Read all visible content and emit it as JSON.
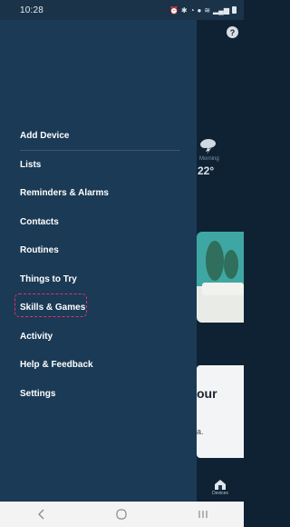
{
  "status_bar": {
    "time": "10:28"
  },
  "drawer": {
    "menu_items": [
      {
        "label": "Add Device",
        "divider": true
      },
      {
        "label": "Lists",
        "divider": false
      },
      {
        "label": "Reminders & Alarms",
        "divider": false
      },
      {
        "label": "Contacts",
        "divider": false
      },
      {
        "label": "Routines",
        "divider": false
      },
      {
        "label": "Things to Try",
        "divider": false
      },
      {
        "label": "Skills & Games",
        "divider": false,
        "highlighted": true
      },
      {
        "label": "Activity",
        "divider": false
      },
      {
        "label": "Help & Feedback",
        "divider": false
      },
      {
        "label": "Settings",
        "divider": false
      }
    ],
    "highlight_color": "#e6336b"
  },
  "background_app": {
    "help_badge": "?",
    "weather_label": "Morning",
    "weather_temp": "22°",
    "card_text": "our",
    "card_subtext": "a.",
    "devices_label": "Devices"
  },
  "colors": {
    "drawer_bg": "#1b3a55",
    "app_bg": "#0f2233",
    "teal_card": "#3fa7a3"
  }
}
